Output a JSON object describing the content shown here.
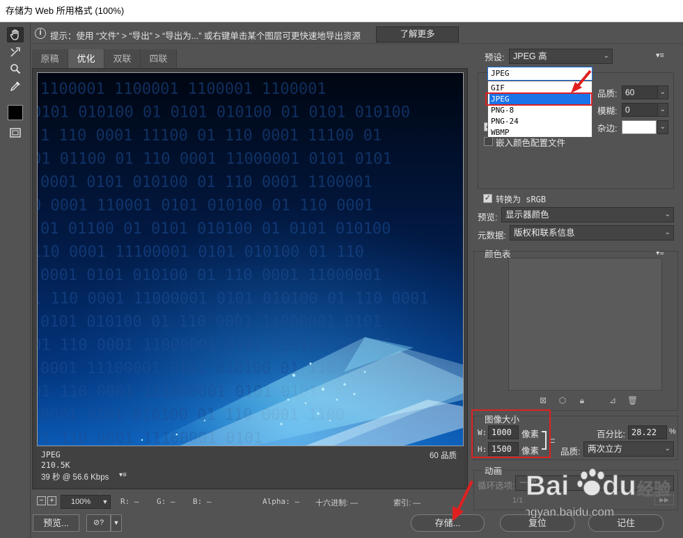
{
  "window": {
    "title": "存储为 Web 所用格式 (100%)"
  },
  "hint": {
    "icon": "info-icon",
    "text": "提示：使用 “文件” > “导出” > “导出为...” 或右键单击某个图层可更快速地导出资源",
    "learn_more": "了解更多"
  },
  "tabs": [
    "原稿",
    "优化",
    "双联",
    "四联"
  ],
  "active_tab": "优化",
  "preview": {
    "format": "JPEG",
    "size": "210.5K",
    "time": "39 秒 @ 56.6 Kbps",
    "quality": "60 品质",
    "binary_rows": [
      "1100001 1100001 1100001 1100001",
      "0101 010100 01 0101 010100 01 0101 010100",
      "1 110 0001 11100 01 110 0001 11100 01",
      "01 01100 01 110 0001 11000001 0101 0101",
      "0001 0101 010100 01 110 0001 1100001",
      "0 0001 110001 0101 010100 01 110 0001",
      "01 01100 01 0101 010100 01 0101 010100",
      "110 0001 11100001 0101 010100 01 110",
      "0001 0101 010100 01 110 0001 11000001",
      "1 110 0001 11000001 0101 010100 01 110 0001",
      "0101 010100 01 110 0001 11000001 0101",
      "01 110 0001 11000001 0101 010100 01 110",
      "0001 11100001 0101 010100 01 110 0001",
      "01 110 0001 111000001 0101 0101",
      "0001 0101 010100 01 110 0001 1100",
      "01 110 0001 11100001 0101"
    ]
  },
  "status": {
    "zoom": "100%",
    "r": "R: —",
    "g": "G: —",
    "b": "B: —",
    "alpha": "Alpha: —",
    "hex": "十六进制: —",
    "index": "索引: —"
  },
  "buttons": {
    "preview": "预览...",
    "save": "存储...",
    "reset": "复位",
    "remember": "记住"
  },
  "settings": {
    "preset_label": "预设:",
    "preset_value": "JPEG 高",
    "format_value": "JPEG",
    "format_options": [
      "GIF",
      "JPEG",
      "PNG-8",
      "PNG-24",
      "WBMP"
    ],
    "quality_label": "品质:",
    "quality_value": "60",
    "blur_label": "模糊:",
    "blur_value": "0",
    "matte_label": "杂边:",
    "embed_profile": "嵌入颜色配置文件",
    "convert_srgb": "转换为 sRGB",
    "preview_label": "预览:",
    "preview_value": "显示器颜色",
    "metadata_label": "元数据:",
    "metadata_value": "版权和联系信息"
  },
  "color_table": {
    "title": "颜色表"
  },
  "image_size": {
    "title": "图像大小",
    "w_label": "W:",
    "w_value": "1000",
    "h_label": "H:",
    "h_value": "1500",
    "unit": "像素",
    "percent_label": "百分比:",
    "percent_value": "28.22",
    "percent_unit": "%",
    "quality_label": "品质:",
    "quality_value": "两次立方"
  },
  "animation": {
    "title": "动画",
    "loop_label": "循环选项:",
    "loop_value": "一次",
    "frame": "1/1"
  },
  "watermark": {
    "brand": "Bai",
    "brand2": "du",
    "cn": "经验",
    "url": "jingyan.baidu.com"
  },
  "colors": {
    "accent": "#1a73e8",
    "annotation": "#e02020",
    "panel": "#535353"
  }
}
